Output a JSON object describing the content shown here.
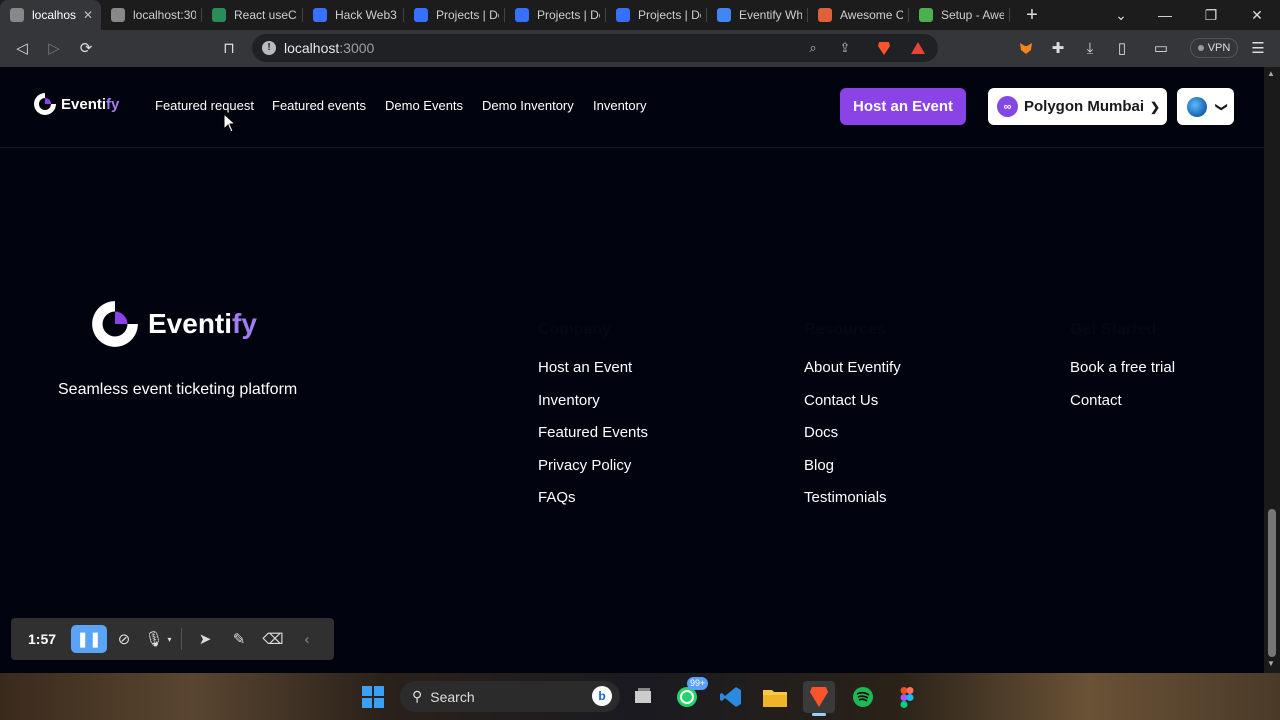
{
  "browser": {
    "tabs": [
      {
        "title": "localhos",
        "icon": "globe-icon",
        "color": "#888888"
      },
      {
        "title": "localhost:30",
        "icon": "globe-icon",
        "color": "#888888"
      },
      {
        "title": "React useCo",
        "icon": "w-icon",
        "color": "#2a8c57"
      },
      {
        "title": "Hack Web3",
        "icon": "devfolio-icon",
        "color": "#3770ff"
      },
      {
        "title": "Projects | De",
        "icon": "devfolio-icon",
        "color": "#3770ff"
      },
      {
        "title": "Projects | De",
        "icon": "devfolio-icon",
        "color": "#3770ff"
      },
      {
        "title": "Projects | De",
        "icon": "devfolio-icon",
        "color": "#3770ff"
      },
      {
        "title": "Eventify Wh",
        "icon": "doc-icon",
        "color": "#4285f4"
      },
      {
        "title": "Awesome C",
        "icon": "awesome-icon",
        "color": "#e0603a"
      },
      {
        "title": "Setup - Awe",
        "icon": "chrome-icon",
        "color": "#4caf50"
      }
    ],
    "address": {
      "host": "localhost",
      "port": ":3000"
    },
    "vpn_label": "VPN"
  },
  "site": {
    "brand": {
      "main": "Eventi",
      "accent": "fy"
    },
    "nav": [
      "Featured request",
      "Featured events",
      "Demo Events",
      "Demo Inventory",
      "Inventory"
    ],
    "host_button": "Host an Event",
    "network_button": "Polygon Mumbai"
  },
  "footer": {
    "tagline": "Seamless event ticketing platform",
    "columns": [
      {
        "heading": "Company",
        "links": [
          "Host an Event",
          "Inventory",
          "Featured Events",
          "Privacy Policy",
          "FAQs"
        ]
      },
      {
        "heading": "Resources",
        "links": [
          "About Eventify",
          "Contact Us",
          "Docs",
          "Blog",
          "Testimonials"
        ]
      },
      {
        "heading": "Get Started",
        "links": [
          "Book a free trial",
          "Contact"
        ]
      }
    ]
  },
  "recorder": {
    "time": "1:57"
  },
  "taskbar": {
    "search_placeholder": "Search",
    "whatsapp_badge": "99+"
  }
}
